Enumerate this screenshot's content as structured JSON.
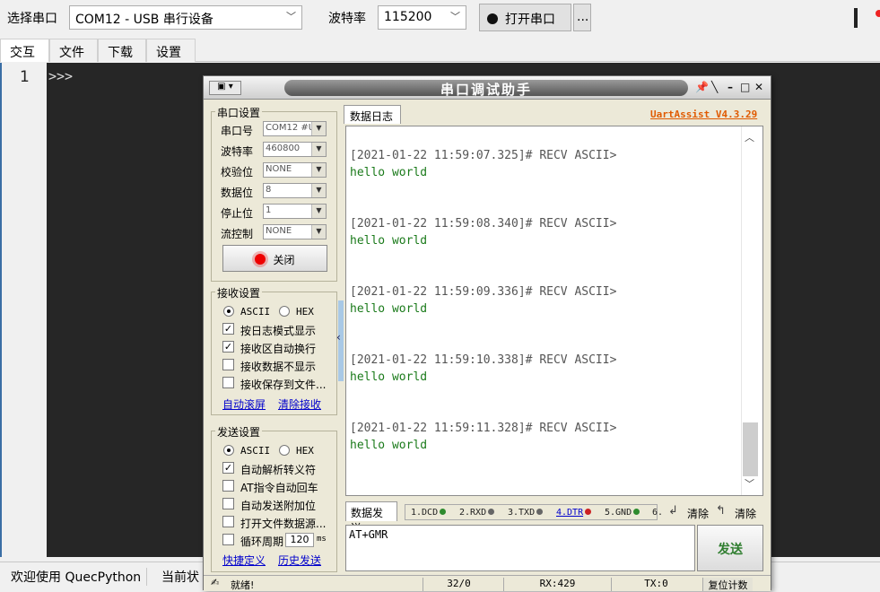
{
  "main": {
    "port_label": "选择串口",
    "port_value": "COM12 - USB 串行设备",
    "baud_label": "波特率",
    "baud_value": "115200",
    "open_button": "打开串口",
    "more_button": "...",
    "tabs": [
      "交互",
      "文件",
      "下载",
      "设置"
    ],
    "line_number": "1",
    "prompt": ">>>",
    "status_welcome": "欢迎使用 QuecPython",
    "status_current": "当前状"
  },
  "uart": {
    "title": "串口调试助手",
    "sys_menu": "▣ ▾",
    "brand": "UartAssist V4.3.29",
    "serial_group": "串口设置",
    "fields": [
      {
        "label": "串口号",
        "value": "COM12 #U"
      },
      {
        "label": "波特率",
        "value": "460800"
      },
      {
        "label": "校验位",
        "value": "NONE"
      },
      {
        "label": "数据位",
        "value": "8"
      },
      {
        "label": "停止位",
        "value": "1"
      },
      {
        "label": "流控制",
        "value": "NONE"
      }
    ],
    "close_button": "关闭",
    "recv_group": "接收设置",
    "recv_ascii": "ASCII",
    "recv_hex": "HEX",
    "recv_options": [
      "按日志模式显示",
      "接收区自动换行",
      "接收数据不显示",
      "接收保存到文件..."
    ],
    "recv_options_checked": [
      true,
      true,
      false,
      false
    ],
    "recv_link1": "自动滚屏",
    "recv_link2": "清除接收",
    "send_group": "发送设置",
    "send_ascii": "ASCII",
    "send_hex": "HEX",
    "send_options": [
      "自动解析转义符",
      "AT指令自动回车",
      "自动发送附加位",
      "打开文件数据源...",
      "循环周期"
    ],
    "send_options_checked": [
      true,
      false,
      false,
      false,
      false
    ],
    "cycle_value": "120",
    "cycle_unit": "ms",
    "send_link1": "快捷定义",
    "send_link2": "历史发送",
    "log_tab": "数据日志",
    "log": [
      {
        "header": "[2021-01-22 11:59:07.325]# RECV ASCII>",
        "body": "hello world"
      },
      {
        "header": "[2021-01-22 11:59:08.340]# RECV ASCII>",
        "body": "hello world"
      },
      {
        "header": "[2021-01-22 11:59:09.336]# RECV ASCII>",
        "body": "hello world"
      },
      {
        "header": "[2021-01-22 11:59:10.338]# RECV ASCII>",
        "body": "hello world"
      },
      {
        "header": "[2021-01-22 11:59:11.328]# RECV ASCII>",
        "body": "hello world"
      }
    ],
    "send_tab": "数据发送",
    "signals": [
      {
        "label": "1.DCD",
        "color": "#2e8b2e"
      },
      {
        "label": "2.RXD",
        "color": "#555555"
      },
      {
        "label": "3.TXD",
        "color": "#555555"
      },
      {
        "label": "4.DTR",
        "color": "#cc2222"
      },
      {
        "label": "5.GND",
        "color": "#2e8b2e"
      },
      {
        "label": "6.",
        "color": ""
      }
    ],
    "clear1": "清除",
    "clear2": "清除",
    "send_text": "AT+GMR",
    "send_button": "发送",
    "status_ready": "就绪!",
    "status_count": "32/0",
    "status_rx": "RX:429",
    "status_tx": "TX:0",
    "status_reset": "复位计数"
  }
}
